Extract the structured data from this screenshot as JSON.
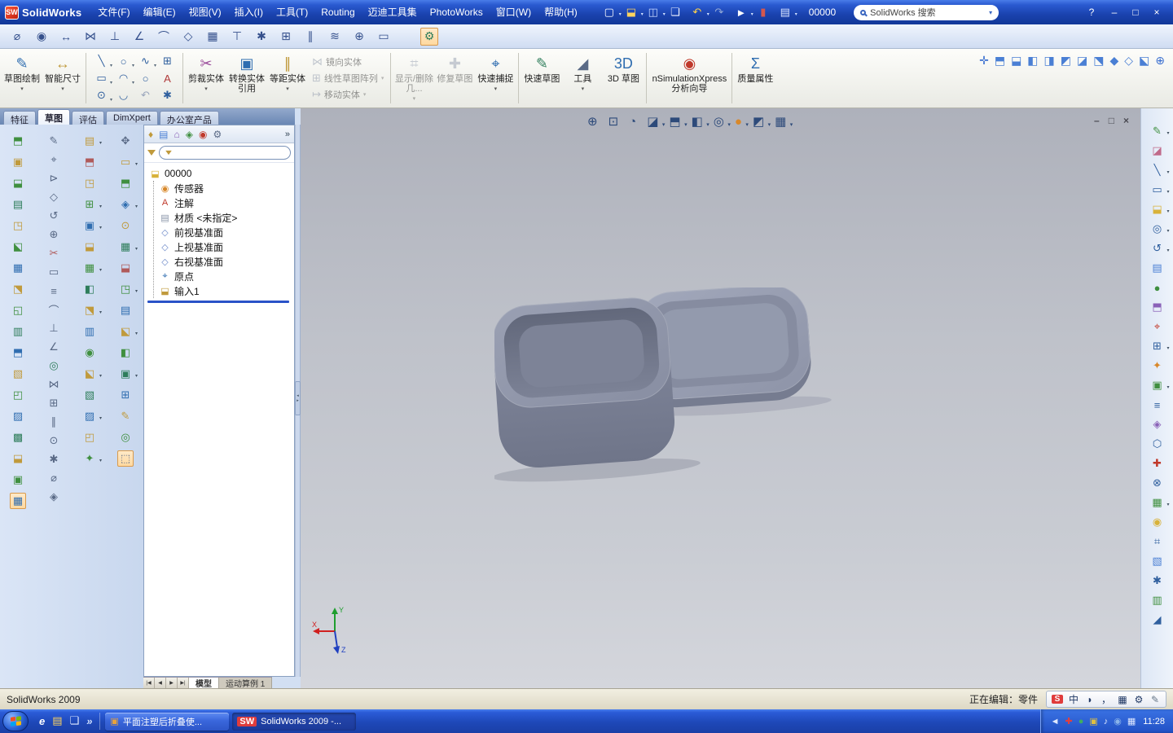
{
  "colors": {
    "titlebar_blue": "#1a42ae",
    "taskbar_blue": "#1e48b8",
    "viewport_gray": "#bfc2ca",
    "rollback_blue": "#2a52c8",
    "highlight_orange": "#d89a4c",
    "model_gray": "#8b91a5"
  },
  "titlebar": {
    "app_name": "SolidWorks",
    "menus": [
      "文件(F)",
      "编辑(E)",
      "视图(V)",
      "插入(I)",
      "工具(T)",
      "Routing",
      "迈迪工具集",
      "PhotoWorks",
      "窗口(W)",
      "帮助(H)"
    ],
    "std_icons": [
      "▢|#f8fbff|a",
      "⬓|#ffd45e|a",
      "◫|#c2d6ff|a",
      "❏|#eef2ff",
      "↶|#ffd24a|a",
      "↷|#93a9d6",
      "►|#ffffff|a",
      "▮|#d4574e",
      "▤|#d8e4ff|a"
    ],
    "doc_id": "00000",
    "search_placeholder": "SolidWorks 搜索",
    "help_label": "?",
    "win_buttons": [
      "–",
      "□",
      "×"
    ]
  },
  "toolbar2": {
    "icons": [
      "⌀|#35508c",
      "◉|#35508c",
      "↔|#35508c",
      "⋈|#35508c",
      "⊥|#35508c",
      "∠|#35508c",
      "⌒|#35508c",
      "◇|#35508c",
      "▦|#35508c",
      "⊤|#35508c",
      "✱|#35508c",
      "⊞|#35508c",
      "∥|#35508c",
      "≋|#35508c",
      "⊕|#35508c",
      "▭|#35508c",
      "⚙|#2e7d5b|p"
    ]
  },
  "ribbon": {
    "group1": [
      {
        "icon": "✎|#2f6db0",
        "label": "草图绘制",
        "cls": "has-arr"
      },
      {
        "icon": "↔|#c09a3c",
        "label": "智能尺寸",
        "cls": "has-arr"
      }
    ],
    "minigrid": [
      "╲|#2f5f9e|a",
      "○|#2f5f9e|a",
      "∿|#2f5f9e|a",
      "⊞|#2f5f9e",
      "▭|#2f5f9e|a",
      "◠|#2f5f9e|a",
      "○|#2f5f9e",
      "A|#b03a3a",
      "⊙|#2f5f9e|a",
      "◡|#2f5f9e",
      "↶|#9aa6bc",
      "✱|#2f5f9e"
    ],
    "group2": [
      {
        "icon": "✂|#9a4a9a",
        "label": "剪裁实体",
        "cls": "has-arr"
      },
      {
        "icon": "▣|#2f6db0",
        "label": "转换实体引用",
        "cls": ""
      },
      {
        "icon": "∥|#c09a3c",
        "label": "等距实体",
        "cls": "has-arr"
      }
    ],
    "stack3": [
      {
        "icon": "⋈|#8a94a8",
        "label": "镜向实体",
        "cls": "dim"
      },
      {
        "icon": "⊞|#8a94a8",
        "label": "线性草图阵列",
        "cls": "dim has-arr"
      },
      {
        "icon": "↦|#8a94a8",
        "label": "移动实体",
        "cls": "dim has-arr"
      }
    ],
    "group3": [
      {
        "icon": "⌗|#8a94a8",
        "label": "显示/删除几...",
        "cls": "dim has-arr"
      },
      {
        "icon": "✚|#8a94a8",
        "label": "修复草图",
        "cls": "dim"
      },
      {
        "icon": "⌖|#2f6db0",
        "label": "快速捕捉",
        "cls": "has-arr"
      }
    ],
    "group4": [
      {
        "icon": "✎|#2e7d5b",
        "label": "快速草图",
        "cls": ""
      },
      {
        "icon": "◢|#5a6a86",
        "label": "工具",
        "cls": "has-arr"
      },
      {
        "icon": "3D|#2f6db0",
        "label": "3D 草图",
        "cls": ""
      }
    ],
    "group5": [
      {
        "icon": "◉|#c0392b",
        "label": "nSimulationXpress 分析向导",
        "cls": "wide"
      }
    ],
    "group6": [
      {
        "icon": "Σ|#2f6db0",
        "label": "质量属性",
        "cls": ""
      }
    ],
    "view_icons": [
      "✛|#3a6fd0",
      "⬒|#4a7fd4",
      "⬓|#4a7fd4",
      "◧|#4a7fd4",
      "◨|#4a7fd4",
      "◩|#4a7fd4",
      "◪|#4a7fd4",
      "⬔|#4a7fd4",
      "◆|#4a7fd4",
      "◇|#4a7fd4",
      "⬕|#4a7fd4",
      "⊕|#3a6fd0"
    ]
  },
  "tabs": [
    {
      "label": "特征",
      "cls": ""
    },
    {
      "label": "草图",
      "cls": "active"
    },
    {
      "label": "评估",
      "cls": ""
    },
    {
      "label": "DimXpert",
      "cls": ""
    },
    {
      "label": "办公室产品",
      "cls": ""
    }
  ],
  "left_toolbars": {
    "col1": [
      "⬒|#3f8f3f",
      "▣|#c09a3c",
      "⬓|#3f8f3f",
      "▤|#2e7d5b",
      "◳|#c09a3c",
      "⬕|#3f8f3f",
      "▦|#2f6db0",
      "⬔|#c09a3c",
      "◱|#3f8f3f",
      "▥|#2e7d5b",
      "⬒|#2f6db0",
      "▧|#c09a3c",
      "◰|#3f8f3f",
      "▨|#2f6db0",
      "▩|#2e7d5b",
      "⬓|#c09a3c",
      "▣|#3f8f3f",
      "▦|#2f6db0|p"
    ],
    "col2": [
      "✎|#5a6a86",
      "⌖|#5a6a86",
      "⊳|#5a6a86",
      "◇|#5a6a86",
      "↺|#5a6a86",
      "⊕|#5a6a86",
      "✂|#b05a5a",
      "▭|#5a6a86",
      "≡|#5a6a86",
      "⌒|#5a6a86",
      "⊥|#5a6a86",
      "∠|#5a6a86",
      "◎|#2e7d5b",
      "⋈|#5a6a86",
      "⊞|#5a6a86",
      "∥|#5a6a86",
      "⊙|#5a6a86",
      "✱|#5a6a86",
      "⌀|#5a6a86",
      "◈|#5a6a86"
    ],
    "col3": [
      "▤|#c09a3c|a",
      "⬒|#b05a5a",
      "◳|#c09a3c",
      "⊞|#3f8f3f|a",
      "▣|#2f6db0|a",
      "⬓|#c09a3c",
      "▦|#3f8f3f|a",
      "◧|#2e7d5b",
      "⬔|#c09a3c|a",
      "▥|#2f6db0",
      "◉|#3f8f3f",
      "⬕|#c09a3c|a",
      "▧|#2e7d5b",
      "▨|#2f6db0|a",
      "◰|#c09a3c",
      "✦|#3f8f3f|a"
    ],
    "col4": [
      "✥|#5a6a86",
      "▭|#c09a3c|a",
      "⬒|#3f8f3f",
      "◈|#2f6db0|a",
      "⊙|#c09a3c",
      "▦|#2e7d5b|a",
      "⬓|#b05a5a",
      "◳|#3f8f3f|a",
      "▤|#2f6db0",
      "⬕|#c09a3c|a",
      "◧|#3f8f3f",
      "▣|#2e7d5b|a",
      "⊞|#2f6db0",
      "✎|#c09a3c",
      "◎|#3f8f3f",
      "⬚|#5a6a86|p"
    ]
  },
  "feature_panel": {
    "fm_icons": [
      "♦|#c09a3c",
      "▤|#4a7fd4",
      "⌂|#8a62b8",
      "◈|#3f8f3f",
      "◉|#c0392b",
      "⚙|#5a6a86"
    ],
    "overflow": "»",
    "tree_root": {
      "icon": "⬓|#d8b23a",
      "label": "00000"
    },
    "tree_items": [
      {
        "icon": "◉|#d8882a",
        "label": "传感器"
      },
      {
        "icon": "A|#c0392b",
        "label": "注解"
      },
      {
        "icon": "▤|#8a94a8",
        "label": "材质 <未指定>"
      },
      {
        "icon": "◇|#6a87c8",
        "label": "前视基准面"
      },
      {
        "icon": "◇|#6a87c8",
        "label": "上视基准面"
      },
      {
        "icon": "◇|#6a87c8",
        "label": "右视基准面"
      },
      {
        "icon": "⌖|#2f6db0",
        "label": "原点"
      },
      {
        "icon": "⬓|#c09a3c",
        "label": "输入1"
      }
    ]
  },
  "viewport": {
    "hud_icons": [
      "⊕|#2d4a7a",
      "⊡|#2d4a7a",
      "◔|#2d4a7a",
      "◪|#2d4a7a|a",
      "⬒|#2d4a7a|a",
      "◧|#2d4a7a|a",
      "◎|#2d4a7a|a",
      "●|#d8882a|a",
      "◩|#2d4a7a|a",
      "▦|#2d4a7a|a"
    ],
    "doc_controls": [
      "–",
      "□",
      "×"
    ],
    "triad": {
      "x": "X",
      "y": "Y",
      "z": "Z"
    }
  },
  "right_toolbar": {
    "icons": [
      "✎|#3f8f3f|a",
      "◪|#c06a8a",
      "╲|#2f5f9e|a",
      "▭|#2f5f9e|a",
      "⬓|#d8b23a|a",
      "◎|#2f5f9e|a",
      "↺|#2f5f9e|a",
      "▤|#4a7fd4",
      "●|#3f8f3f",
      "⬒|#8a62b8",
      "⌖|#c0392b",
      "⊞|#2f5f9e|a",
      "✦|#d8882a",
      "▣|#3f8f3f|a",
      "≡|#2f5f9e",
      "◈|#8a62b8",
      "⬡|#2f5f9e",
      "✚|#c0392b",
      "⊗|#2f5f9e",
      "▦|#3f8f3f|a",
      "◉|#d8b23a",
      "⌗|#2f5f9e",
      "▧|#4a7fd4",
      "✱|#2f5f9e",
      "▥|#3f8f3f",
      "◢|#2f5f9e"
    ]
  },
  "bottom_tabs": {
    "nav": [
      "|◀",
      "◀",
      "▶",
      "▶|"
    ],
    "tabs": [
      {
        "label": "模型",
        "cls": "active"
      },
      {
        "label": "运动算例 1",
        "cls": ""
      }
    ]
  },
  "statusbar": {
    "left": "SolidWorks 2009",
    "editing": "正在编辑：零件",
    "ime": [
      "S|#ffffff|s",
      "中|#223a66",
      "◗|#223a66",
      "，|#223a66",
      "▦|#223a66",
      "⚙|#223a66",
      "✎|#667788"
    ]
  },
  "taskbar": {
    "quick_launch": [
      "e|#ffffff",
      "▤|#ffd45e",
      "❏|#dfe8ff",
      "»|#cfe0ff"
    ],
    "tasks": [
      {
        "icon": "▣|#e8a23c",
        "label": "平面注塑后折叠使...",
        "cls": ""
      },
      {
        "icon": "SW|#ffffff|s",
        "label": "SolidWorks 2009 -...",
        "cls": "active"
      }
    ],
    "tray": [
      "◄|#dfe8ff",
      "✚|#e04040",
      "●|#3fae5f",
      "▣|#e0c040",
      "♪|#dfe8ff",
      "◉|#8ab4ea",
      "▦|#dfe8ff"
    ],
    "clock": "11:28"
  }
}
